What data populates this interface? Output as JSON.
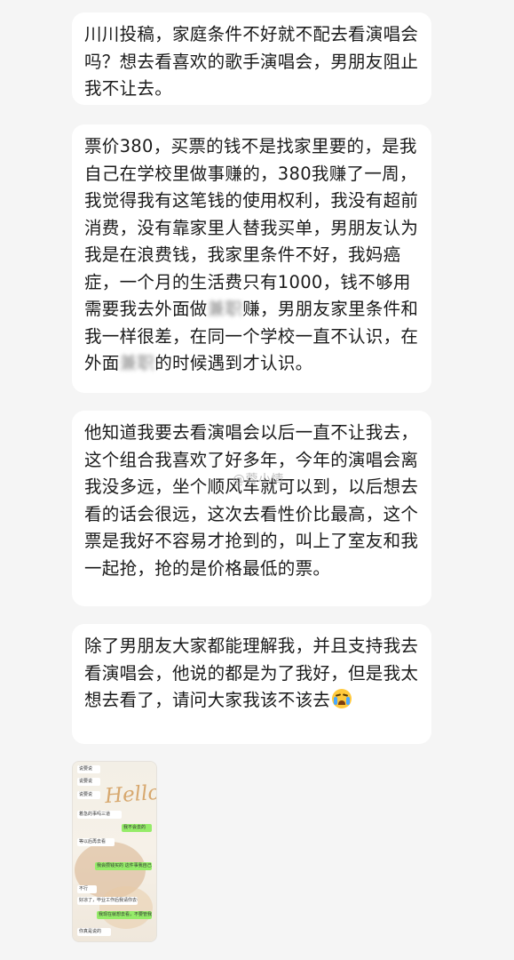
{
  "messages": [
    {
      "text": "川川投稿，家庭条件不好就不配去看演唱会吗？想去看喜欢的歌手演唱会，男朋友阻止我不让去。"
    },
    {
      "text_a": "票价380，买票的钱不是找家里要的，是我自己在学校里做事赚的，380我赚了一周，我觉得我有这笔钱的使用权利，我没有超前消费，没有靠家里人替我买单，男朋友认为我是在浪费钱，我家里条件不好，我妈癌症，一个月的生活费只有1000，钱不够用需要我去外面做",
      "blur_a": "兼职",
      "text_b": "赚，男朋友家里条件和我一样很差，在同一个学校一直不认识，在外面",
      "blur_b": "兼职",
      "text_c": "的时候遇到才认识。"
    },
    {
      "text": "他知道我要去看演唱会以后一直不让我去，这个组合我喜欢了好多年，今年的演唱会离我没多远，坐个顺风车就可以到，以后想去看的话会很远，这次去看性价比最高，这个票是我好不容易才抢到的，叫上了室友和我一起抢，抢的是价格最低的票。"
    },
    {
      "text": "除了男朋友大家都能理解我，并且支持我去看演唱会，他说的都是为了我好，但是我太想去看了，请问大家我该不该去",
      "emoji": "loudly-crying-face-icon"
    }
  ],
  "watermark": "@蓉小情",
  "attachment": {
    "hello_text": "Hello",
    "time": "11:24",
    "rows": [
      {
        "side": "left",
        "text": "说要说"
      },
      {
        "side": "left",
        "text": "说要说"
      },
      {
        "side": "left",
        "text": "说要说"
      },
      {
        "side": "left",
        "text": "着急的事吗三道"
      },
      {
        "side": "right",
        "text": "我不会去的"
      },
      {
        "side": "left",
        "text": "等以后再去看"
      },
      {
        "side": "right",
        "text": "我会攒钱买的 这件事我自己决定了"
      },
      {
        "side": "left",
        "text": "不行"
      },
      {
        "side": "left",
        "text": "好凉了，毕业工作后我请你去看"
      },
      {
        "side": "right",
        "text": "我现在就想去看，不要管我了"
      },
      {
        "side": "left",
        "text": "你真是说的"
      }
    ]
  },
  "colors": {
    "background": "#f5f5f5",
    "bubble": "#ffffff",
    "text": "#1a1a1a",
    "wechat_green": "#95ec69"
  }
}
